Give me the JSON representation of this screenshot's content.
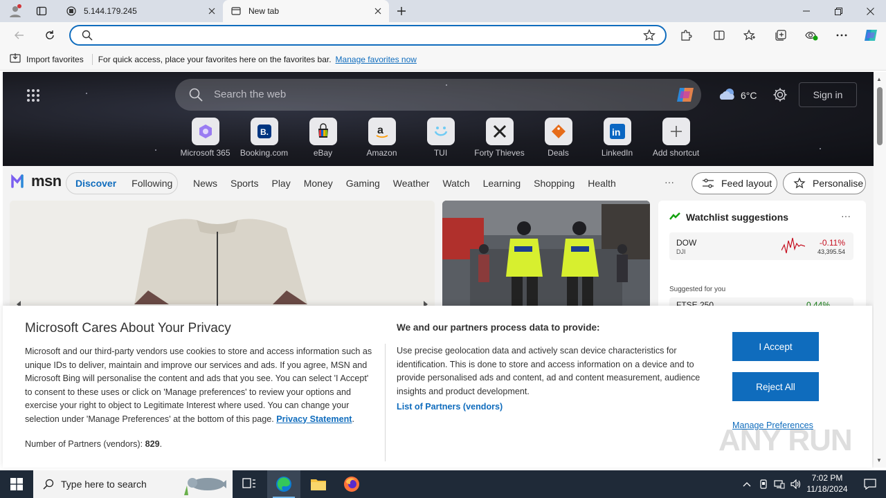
{
  "browser": {
    "tabs": [
      {
        "title": "5.144.179.245",
        "icon": "document-icon"
      },
      {
        "title": "New tab",
        "icon": "newtab-icon"
      }
    ],
    "address": {
      "value": "",
      "placeholder": ""
    },
    "favorites_bar": {
      "import_label": "Import favorites",
      "message": "For quick access, place your favorites here on the favorites bar.",
      "manage_link": "Manage favorites now"
    }
  },
  "msn": {
    "search_placeholder": "Search the web",
    "weather": {
      "temperature": "6°C",
      "icon": "cloud-icon"
    },
    "sign_in": "Sign in",
    "shortcuts": [
      {
        "label": "Microsoft 365",
        "icon": "microsoft365-icon",
        "color": "#7b5ff0"
      },
      {
        "label": "Booking.com",
        "icon": "booking-icon",
        "color": "#003580"
      },
      {
        "label": "eBay",
        "icon": "ebay-icon",
        "color": "#e53238"
      },
      {
        "label": "Amazon",
        "icon": "amazon-icon",
        "color": "#222222"
      },
      {
        "label": "TUI",
        "icon": "tui-icon",
        "color": "#70cbf4"
      },
      {
        "label": "Forty Thieves",
        "icon": "swords-icon",
        "color": "#222222"
      },
      {
        "label": "Deals",
        "icon": "tag-icon",
        "color": "#e66c1a"
      },
      {
        "label": "LinkedIn",
        "icon": "linkedin-icon",
        "color": "#0a66c2"
      },
      {
        "label": "Add shortcut",
        "icon": "plus-icon",
        "color": "#555555"
      }
    ],
    "logo_text": "msn",
    "feed_tabs": {
      "discover": "Discover",
      "following": "Following"
    },
    "nav": [
      "News",
      "Sports",
      "Play",
      "Money",
      "Gaming",
      "Weather",
      "Watch",
      "Learning",
      "Shopping",
      "Health"
    ],
    "more": "···",
    "feed_layout": "Feed layout",
    "personalise": "Personalise",
    "watchlist": {
      "title": "Watchlist suggestions",
      "more": "···",
      "stock": {
        "ticker": "DOW",
        "exchange": "DJI",
        "change": "-0.11%",
        "price": "43,395.54"
      },
      "suggested_label": "Suggested for you",
      "stock2": {
        "ticker": "FTSE 250",
        "change": "0.44%"
      }
    }
  },
  "privacy": {
    "title": "Microsoft Cares About Your Privacy",
    "body": "Microsoft and our third-party vendors use cookies to store and access information such as unique IDs to deliver, maintain and improve our services and ads. If you agree, MSN and Microsoft Bing will personalise the content and ads that you see. You can select 'I Accept' to consent to these uses or click on 'Manage preferences' to review your options and exercise your right to object to Legitimate Interest where used.  You can change your selection under 'Manage Preferences' at the bottom of this page.",
    "privacy_link": "Privacy Statement",
    "partners_label": "Number of Partners (vendors):",
    "partners_count": "829",
    "subtitle": "We and our partners process data to provide:",
    "description": "Use precise geolocation data and actively scan device characteristics for identification. This is done to store and access information on a device and to provide personalised ads and content, ad and content measurement, audience insights and product development.",
    "list_link": "List of Partners (vendors)",
    "accept": "I Accept",
    "reject": "Reject All",
    "manage": "Manage Preferences",
    "watermark": "ANY RUN"
  },
  "taskbar": {
    "search_placeholder": "Type here to search",
    "time": "7:02 PM",
    "date": "11/18/2024"
  },
  "colors": {
    "accent": "#0f6cbd",
    "negative": "#c50f1f",
    "positive": "#107c10"
  }
}
